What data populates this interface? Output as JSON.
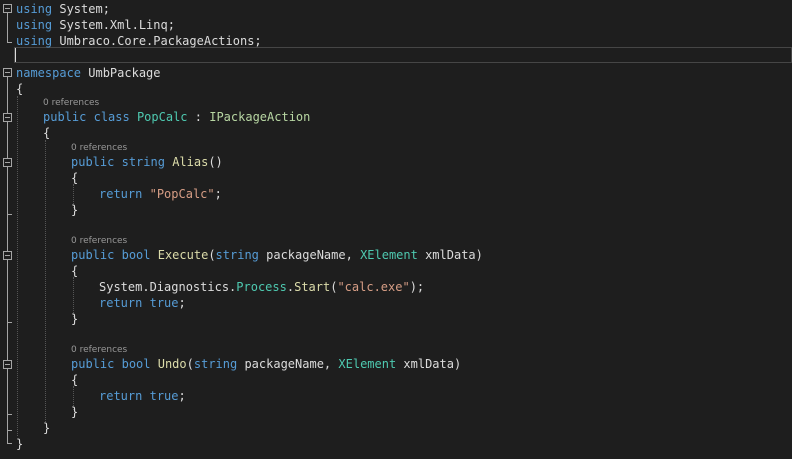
{
  "colors": {
    "background": "#1e1e1e",
    "keyword": "#569cd6",
    "type": "#4ec9b0",
    "method": "#dcdcaa",
    "string": "#d69d85",
    "plain": "#dcdcdc",
    "codelens": "#999999",
    "namespace_word": "#c8c8c8"
  },
  "codelens": {
    "class_refs": "0 references",
    "alias_refs": "0 references",
    "execute_refs": "0 references",
    "undo_refs": "0 references"
  },
  "code": {
    "line1": {
      "kw": "using",
      "rest": " System;"
    },
    "line2": {
      "kw": "using",
      "rest": " System.Xml.Linq;"
    },
    "line3": {
      "kw": "using",
      "rest": " Umbraco.Core.PackageActions;"
    },
    "line4": "",
    "line5": {
      "kw": "namespace",
      "name": " UmbPackage"
    },
    "line6": "{",
    "line7": {
      "kw1": "public",
      "sp1": " ",
      "kw2": "class",
      "sp2": " ",
      "name": "PopCalc",
      "sep": " : ",
      "iface": "IPackageAction"
    },
    "line8": "{",
    "line9": {
      "kw1": "public",
      "sp1": " ",
      "kw2": "string",
      "sp2": " ",
      "name": "Alias",
      "rest": "()"
    },
    "line10": "{",
    "line11": {
      "kw": "return",
      "sp": " ",
      "str": "\"PopCalc\"",
      "end": ";"
    },
    "line12": "}",
    "line13": {
      "kw1": "public",
      "sp1": " ",
      "kw2": "bool",
      "sp2": " ",
      "name": "Execute",
      "open": "(",
      "kw3": "string",
      "p1": " packageName, ",
      "type": "XElement",
      "p2": " xmlData)"
    },
    "line14": "{",
    "line15": {
      "a": "System.Diagnostics.",
      "type": "Process",
      "dot": ".",
      "m": "Start",
      "open": "(",
      "str": "\"calc.exe\"",
      "end": ");"
    },
    "line16": {
      "kw": "return",
      "sp": " ",
      "kw2": "true",
      "end": ";"
    },
    "line17": "}",
    "line18": {
      "kw1": "public",
      "sp1": " ",
      "kw2": "bool",
      "sp2": " ",
      "name": "Undo",
      "open": "(",
      "kw3": "string",
      "p1": " packageName, ",
      "type": "XElement",
      "p2": " xmlData)"
    },
    "line19": "{",
    "line20": {
      "kw": "return",
      "sp": " ",
      "kw2": "true",
      "end": ";"
    },
    "line21": "}",
    "line22": "}",
    "line23": "}"
  }
}
